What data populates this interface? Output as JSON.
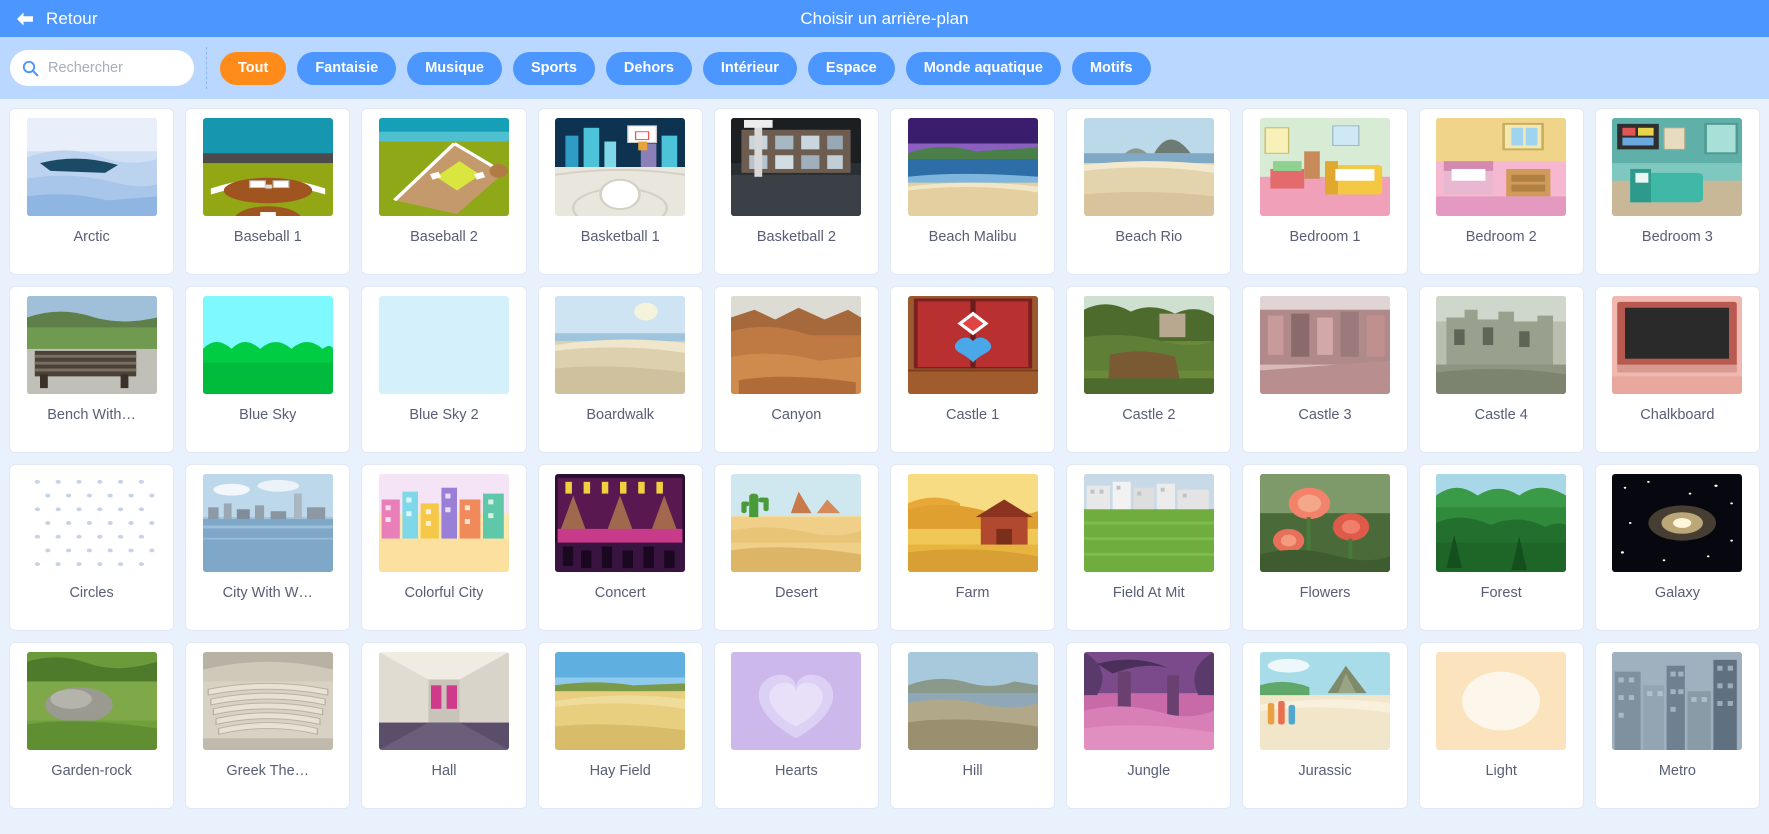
{
  "header": {
    "back_label": "Retour",
    "back_icon": "arrow-left-icon",
    "title": "Choisir un arrière-plan",
    "bar_color": "#4c97ff"
  },
  "filterbar": {
    "background": "#b9d7ff",
    "search": {
      "icon": "search-icon",
      "placeholder": "Rechercher",
      "value": ""
    },
    "active_tag": "Tout",
    "active_color": "#ff8c1a",
    "tag_color": "#4c97ff",
    "tags": [
      "Tout",
      "Fantaisie",
      "Musique",
      "Sports",
      "Dehors",
      "Intérieur",
      "Espace",
      "Monde aquatique",
      "Motifs"
    ]
  },
  "grid": {
    "columns": 10,
    "items": [
      {
        "label": "Arctic",
        "art": "arctic"
      },
      {
        "label": "Baseball 1",
        "art": "baseball1"
      },
      {
        "label": "Baseball 2",
        "art": "baseball2"
      },
      {
        "label": "Basketball 1",
        "art": "basketball1"
      },
      {
        "label": "Basketball 2",
        "art": "basketball2"
      },
      {
        "label": "Beach Malibu",
        "art": "beachmalibu"
      },
      {
        "label": "Beach Rio",
        "art": "beachrio"
      },
      {
        "label": "Bedroom 1",
        "art": "bedroom1"
      },
      {
        "label": "Bedroom 2",
        "art": "bedroom2"
      },
      {
        "label": "Bedroom 3",
        "art": "bedroom3"
      },
      {
        "label": "Bench With…",
        "art": "bench"
      },
      {
        "label": "Blue Sky",
        "art": "bluesky"
      },
      {
        "label": "Blue Sky 2",
        "art": "bluesky2"
      },
      {
        "label": "Boardwalk",
        "art": "boardwalk"
      },
      {
        "label": "Canyon",
        "art": "canyon"
      },
      {
        "label": "Castle 1",
        "art": "castle1"
      },
      {
        "label": "Castle 2",
        "art": "castle2"
      },
      {
        "label": "Castle 3",
        "art": "castle3"
      },
      {
        "label": "Castle 4",
        "art": "castle4"
      },
      {
        "label": "Chalkboard",
        "art": "chalkboard"
      },
      {
        "label": "Circles",
        "art": "circles"
      },
      {
        "label": "City With W…",
        "art": "citywater"
      },
      {
        "label": "Colorful City",
        "art": "colorfulcity"
      },
      {
        "label": "Concert",
        "art": "concert"
      },
      {
        "label": "Desert",
        "art": "desert"
      },
      {
        "label": "Farm",
        "art": "farm"
      },
      {
        "label": "Field At Mit",
        "art": "fieldmit"
      },
      {
        "label": "Flowers",
        "art": "flowers"
      },
      {
        "label": "Forest",
        "art": "forest"
      },
      {
        "label": "Galaxy",
        "art": "galaxy"
      },
      {
        "label": "Garden-rock",
        "art": "gardenrock"
      },
      {
        "label": "Greek The…",
        "art": "greek"
      },
      {
        "label": "Hall",
        "art": "hall"
      },
      {
        "label": "Hay Field",
        "art": "hayfield"
      },
      {
        "label": "Hearts",
        "art": "hearts"
      },
      {
        "label": "Hill",
        "art": "hill"
      },
      {
        "label": "Jungle",
        "art": "jungle"
      },
      {
        "label": "Jurassic",
        "art": "jurassic"
      },
      {
        "label": "Light",
        "art": "light"
      },
      {
        "label": "Metro",
        "art": "metro"
      }
    ]
  }
}
